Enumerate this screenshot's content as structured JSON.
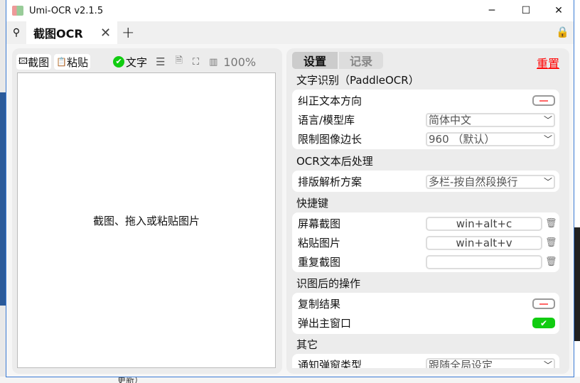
{
  "window": {
    "title": "Umi-OCR v2.1.5",
    "minimize": "─",
    "maximize": "☐",
    "close": "✕"
  },
  "tabbar": {
    "pin": "⚲",
    "tab_label": "截图OCR",
    "tab_close": "✕",
    "add": "+",
    "lock": "🔒"
  },
  "left": {
    "screenshot": "截图",
    "paste": "粘贴",
    "text_toggle": "文字",
    "zoom": "100%",
    "placeholder": "截图、拖入或粘贴图片"
  },
  "right": {
    "tabs": [
      "设置",
      "记录"
    ],
    "reset": "重置",
    "sections": {
      "ocr": {
        "title": "文字识别（PaddleOCR）",
        "correct": "纠正文本方向",
        "lang_label": "语言/模型库",
        "lang_value": "简体中文",
        "limit_label": "限制图像边长",
        "limit_value": "960 （默认）"
      },
      "post": {
        "title": "OCR文本后处理",
        "layout_label": "排版解析方案",
        "layout_value": "多栏-按自然段换行"
      },
      "hotkey": {
        "title": "快捷键",
        "screen": "屏幕截图",
        "screen_key": "win+alt+c",
        "paste": "粘贴图片",
        "paste_key": "win+alt+v",
        "repeat": "重复截图",
        "repeat_key": ""
      },
      "after": {
        "title": "识图后的操作",
        "copy": "复制结果",
        "popup": "弹出主窗口"
      },
      "other": {
        "title": "其它",
        "notify_label": "通知弹窗类型",
        "notify_value": "跟随全局设定"
      }
    }
  },
  "background": {
    "bottom_text": "更新）"
  },
  "colors": {
    "accent_green": "#11cc11",
    "reset_red": "#ff0000"
  }
}
